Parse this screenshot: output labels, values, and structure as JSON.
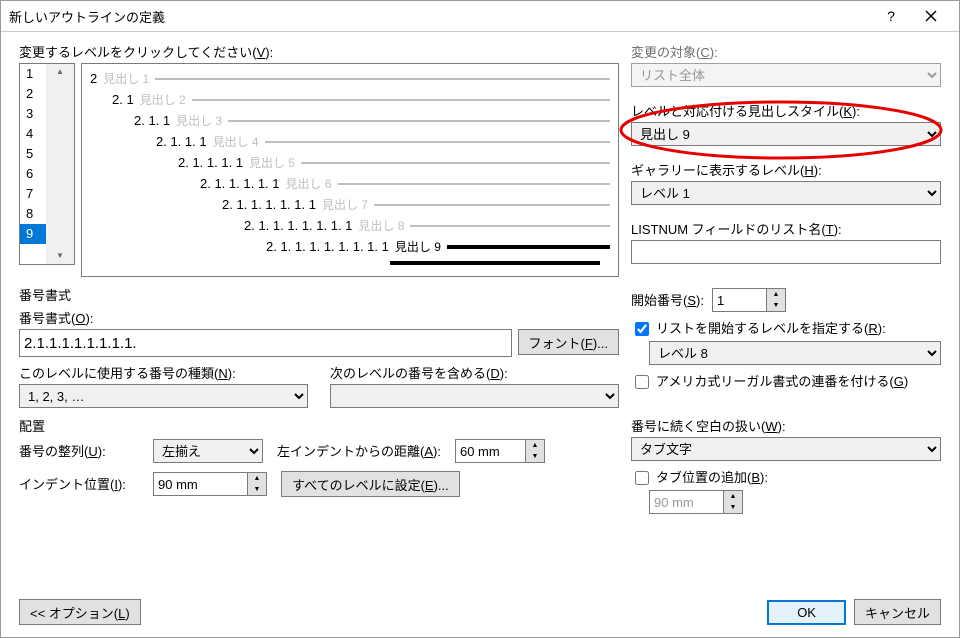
{
  "titlebar": {
    "title": "新しいアウトラインの定義"
  },
  "level_prompt": {
    "pre": "変更するレベルをクリックしてください(",
    "key": "V",
    "post": "):"
  },
  "levels": [
    "1",
    "2",
    "3",
    "4",
    "5",
    "6",
    "7",
    "8",
    "9"
  ],
  "selected_level": "9",
  "preview": [
    {
      "num": "2",
      "lbl": "見出し 1",
      "indent": 0
    },
    {
      "num": "2. 1",
      "lbl": "見出し 2",
      "indent": 22
    },
    {
      "num": "2. 1. 1",
      "lbl": "見出し 3",
      "indent": 44
    },
    {
      "num": "2. 1. 1. 1",
      "lbl": "見出し 4",
      "indent": 66
    },
    {
      "num": "2. 1. 1. 1. 1",
      "lbl": "見出し 5",
      "indent": 88
    },
    {
      "num": "2. 1. 1. 1. 1. 1",
      "lbl": "見出し 6",
      "indent": 110
    },
    {
      "num": "2. 1. 1. 1. 1. 1. 1",
      "lbl": "見出し 7",
      "indent": 132
    },
    {
      "num": "2. 1. 1. 1. 1. 1. 1. 1",
      "lbl": "見出し 8",
      "indent": 154
    },
    {
      "num": "2. 1. 1. 1. 1. 1. 1. 1. 1",
      "lbl": "見出し 9",
      "indent": 176,
      "sel": true
    }
  ],
  "apply_to": {
    "label_pre": "変更の対象(",
    "key": "C",
    "label_post": "):",
    "value": "リスト全体"
  },
  "link_style": {
    "label_pre": "レベルと対応付ける見出しスタイル(",
    "key": "K",
    "label_post": "):",
    "value": "見出し 9"
  },
  "gallery": {
    "label_pre": "ギャラリーに表示するレベル(",
    "key": "H",
    "label_post": "):",
    "value": "レベル 1"
  },
  "listnum": {
    "label_pre": "LISTNUM フィールドのリスト名(",
    "key": "T",
    "label_post": "):",
    "value": ""
  },
  "section_format": "番号書式",
  "numfmt": {
    "label_pre": "番号書式(",
    "key": "O",
    "label_post": "):",
    "value": "2.1.1.1.1.1.1.1.1."
  },
  "font_btn": {
    "pre": "フォント(",
    "key": "F",
    "post": "..."
  },
  "numstyle": {
    "label_pre": "このレベルに使用する番号の種類(",
    "key": "N",
    "label_post": "):",
    "value": "1, 2, 3, …"
  },
  "include": {
    "label_pre": "次のレベルの番号を含める(",
    "key": "D",
    "label_post": "):",
    "value": ""
  },
  "startat": {
    "label_pre": "開始番号(",
    "key": "S",
    "label_post": "):",
    "value": "1"
  },
  "restart": {
    "checked": true,
    "label_pre": "リストを開始するレベルを指定する(",
    "key": "R",
    "label_post": "):",
    "value": "レベル 8"
  },
  "legal": {
    "checked": false,
    "label_pre": "アメリカ式リーガル書式の連番を付ける(",
    "key": "G",
    "label_post": ")"
  },
  "section_pos": "配置",
  "align": {
    "label_pre": "番号の整列(",
    "key": "U",
    "label_post": "):",
    "value": "左揃え"
  },
  "align_at": {
    "label_pre": "左インデントからの距離(",
    "key": "A",
    "label_post": "):",
    "value": "60 mm"
  },
  "indent_at": {
    "label_pre": "インデント位置(",
    "key": "I",
    "label_post": "):",
    "value": "90 mm"
  },
  "set_all": {
    "pre": "すべてのレベルに設定(",
    "key": "E",
    "post": "..."
  },
  "follow": {
    "label_pre": "番号に続く空白の扱い(",
    "key": "W",
    "label_post": "):",
    "value": "タブ文字"
  },
  "tabstop": {
    "checked": false,
    "label_pre": "タブ位置の追加(",
    "key": "B",
    "label_post": "):",
    "value": "90 mm"
  },
  "options_btn": {
    "pre": "<< オプション(",
    "key": "L",
    "post": ")"
  },
  "ok": "OK",
  "cancel": "キャンセル"
}
